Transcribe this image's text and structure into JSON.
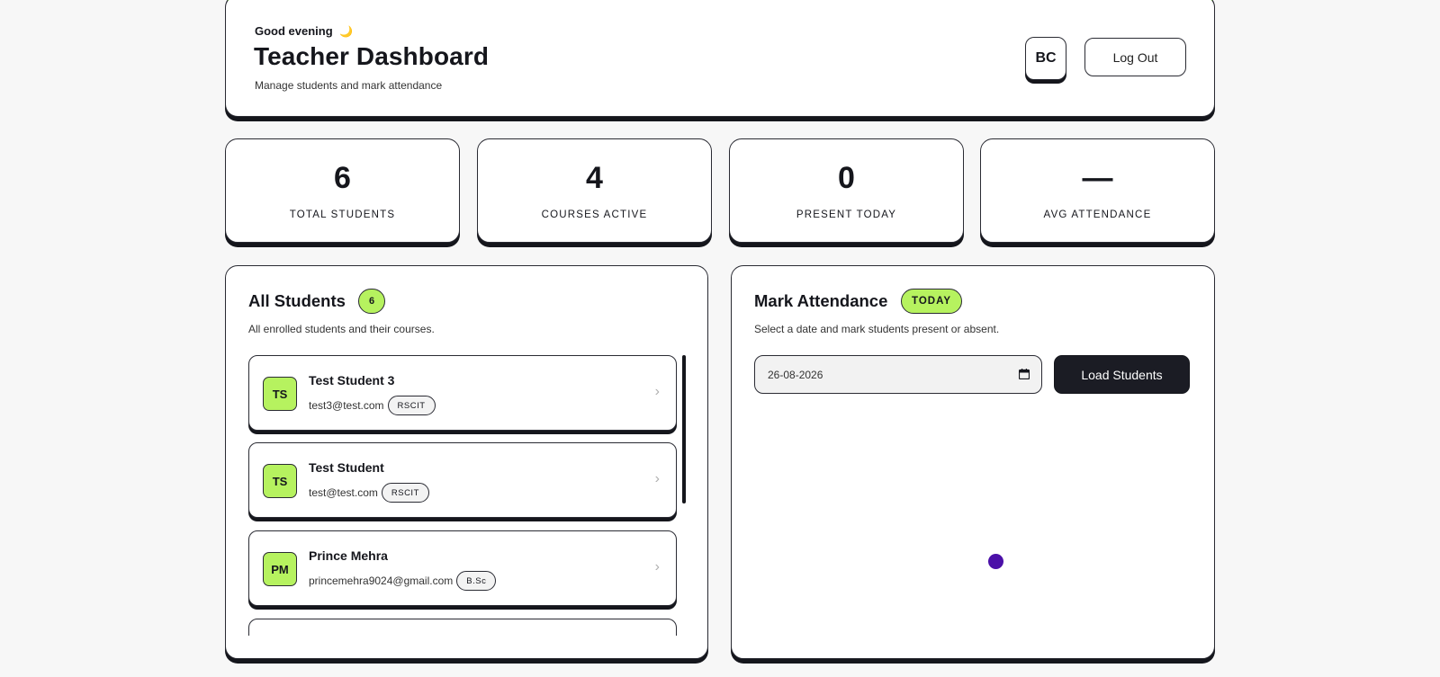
{
  "header": {
    "greeting": "Good evening",
    "greeting_icon": "🌙",
    "title": "Teacher Dashboard",
    "subtitle": "Manage students and mark attendance",
    "avatar_initials": "BC",
    "logout_label": "Log Out"
  },
  "stats": [
    {
      "value": "6",
      "label": "TOTAL STUDENTS"
    },
    {
      "value": "4",
      "label": "COURSES ACTIVE"
    },
    {
      "value": "0",
      "label": "PRESENT TODAY"
    },
    {
      "value": "—",
      "label": "AVG ATTENDANCE"
    }
  ],
  "students_panel": {
    "title": "All Students",
    "count": "6",
    "description": "All enrolled students and their courses.",
    "students": [
      {
        "initials": "TS",
        "name": "Test Student 3",
        "email": "test3@test.com",
        "course": "RSCIT"
      },
      {
        "initials": "TS",
        "name": "Test Student",
        "email": "test@test.com",
        "course": "RSCIT"
      },
      {
        "initials": "PM",
        "name": "Prince Mehra",
        "email": "princemehra9024@gmail.com",
        "course": "B.Sc"
      }
    ]
  },
  "attendance_panel": {
    "title": "Mark Attendance",
    "badge": "TODAY",
    "description": "Select a date and mark students present or absent.",
    "date_value": "26-08-2026",
    "load_label": "Load Students"
  },
  "colors": {
    "accent": "#b6f25f",
    "dark": "#15161c",
    "spinner": "#4b10a8",
    "header_top_border": "#5ecb1f"
  },
  "icons": {
    "greeting": "moon-icon",
    "date": "calendar-icon",
    "student_row": "chevron-right-icon"
  }
}
